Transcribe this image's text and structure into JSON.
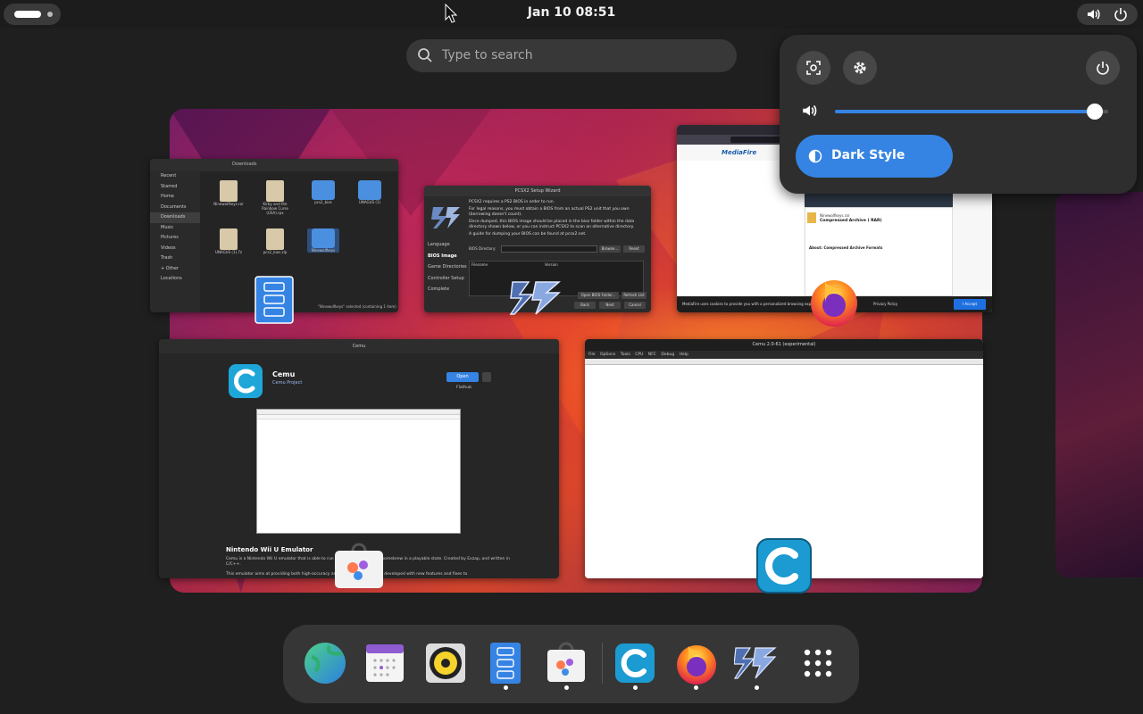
{
  "topbar": {
    "clock": "Jan 10  08:51"
  },
  "search": {
    "placeholder": "Type to search"
  },
  "windows": {
    "files": {
      "path": "Downloads",
      "sidebar": [
        "Recent",
        "Starred",
        "Home",
        "Documents",
        "Downloads",
        "Music",
        "Pictures",
        "Videos",
        "Trash",
        "+ Other Locations"
      ],
      "items": [
        "Ninewolfkeys.rar",
        "Kirby and the Rainbow Curse (USA).rpx",
        "pcs2_bios",
        "UNAGUS (1)",
        "UNAGUS (1).7z",
        "pcs2_bios.zip",
        "Ninewolfkeys"
      ],
      "status": "\"Ninewolfkeys\" selected (containing 1 item)"
    },
    "pcsx2": {
      "title": "PCSX2 Setup Wizard",
      "line1": "PCSX2 requires a PS2 BIOS in order to run.",
      "line2": "For legal reasons, you must obtain a BIOS from an actual PS2 unit that you own (borrowing doesn't count).",
      "line3": "Once dumped, this BIOS image should be placed in the bios folder within the data directory shown below, or you can instruct PCSX2 to scan an alternative directory.",
      "line4": "A guide for dumping your BIOS can be found at pcsx2.net.",
      "menu": [
        "Language",
        "BIOS Image",
        "Game Directories",
        "Controller Setup",
        "Complete"
      ],
      "dir_label": "BIOS Directory:",
      "col_filename": "Filename",
      "col_version": "Version",
      "btn_open": "Open BIOS Folder...",
      "btn_refresh": "Refresh List",
      "btn_back": "Back",
      "btn_next": "Next",
      "btn_cancel": "Cancel",
      "btn_browse": "Browse...",
      "btn_reset": "Reset"
    },
    "browser": {
      "brand": "MediaFire",
      "file_title": "Ninewolfkeys.rar",
      "file_type": "Compressed Archive ( RAR)",
      "about": "About: Compressed Archive Formats",
      "cookie": "MediaFire uses cookies to provide you with a personalized browsing experience.",
      "privacy": "Privacy Policy",
      "accept": "I Accept"
    },
    "software": {
      "header": "Cemu",
      "app_name": "Cemu",
      "developer": "Cemu Project",
      "open_btn": "Open",
      "flathub": "Flathub",
      "subtitle": "Nintendo Wii U Emulator",
      "desc1": "Cemu is a Nintendo Wii U emulator that is able to run most Wii U games and homebrew in a playable state. Created by Exzap, and written in C/C++.",
      "desc2": "This emulator aims at providing both high-accuracy and speed, actively being developed with new features and fixes to"
    },
    "cemu": {
      "title": "Cemu 2.0-61 (experimental)",
      "menu": "File Options Tools CPU NFC Debug Help"
    }
  },
  "quick_settings": {
    "dark_style": "Dark Style",
    "volume": 0.95
  },
  "dock": {
    "items": [
      "browser-globe",
      "calendar",
      "rhythmbox",
      "files",
      "software",
      "cemu",
      "firefox",
      "pcsx2",
      "app-grid"
    ]
  },
  "colors": {
    "accent": "#3584e4",
    "panel": "#2e2e2e",
    "background": "#1f1f1f"
  }
}
